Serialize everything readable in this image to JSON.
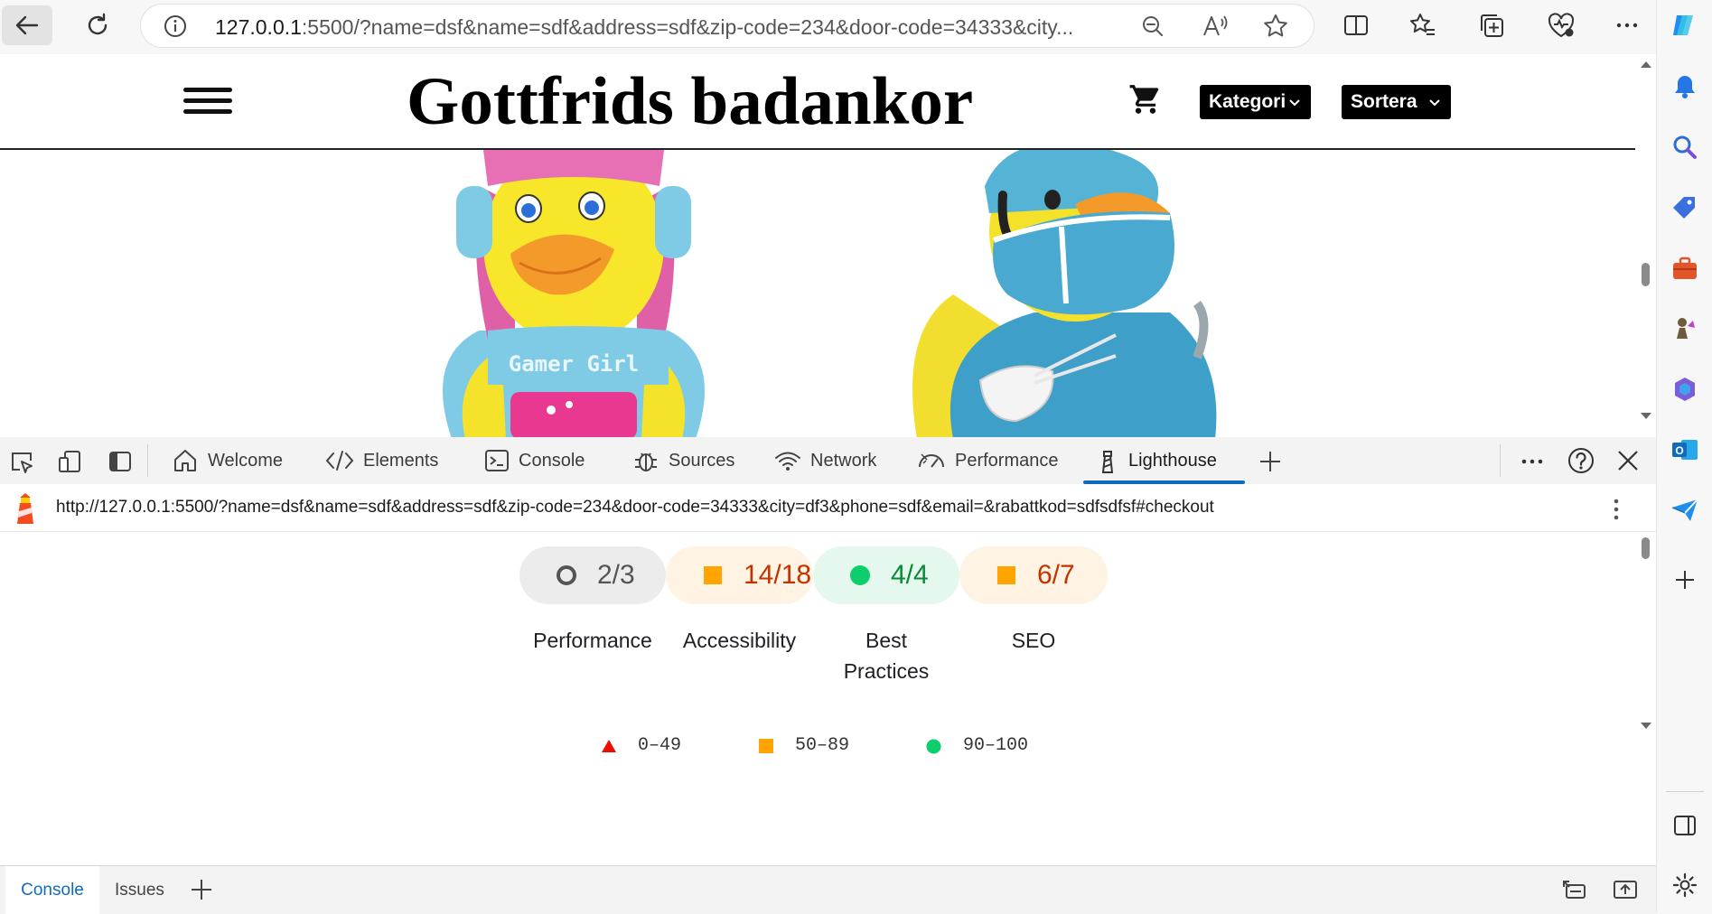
{
  "browser": {
    "address_host": "127.0.0.1",
    "address_rest": ":5500/?name=dsf&name=sdf&address=sdf&zip-code=234&door-code=34333&city..."
  },
  "site": {
    "title": "Gottfrids badankor",
    "kategori_label": "Kategori",
    "sortera_label": "Sortera",
    "duck1_print": "Gamer Girl"
  },
  "devtools": {
    "tabs": {
      "welcome": "Welcome",
      "elements": "Elements",
      "console": "Console",
      "sources": "Sources",
      "network": "Network",
      "performance": "Performance",
      "lighthouse": "Lighthouse"
    },
    "report_url": "http://127.0.0.1:5500/?name=dsf&name=sdf&address=sdf&zip-code=234&door-code=34333&city=df3&phone=sdf&email=&rabattkod=sdfsdfsf#checkout",
    "scores": [
      {
        "label": "Performance",
        "value": "2/3",
        "status": "neutral"
      },
      {
        "label": "Accessibility",
        "value": "14/18",
        "status": "average"
      },
      {
        "label_line1": "Best",
        "label_line2": "Practices",
        "value": "4/4",
        "status": "pass"
      },
      {
        "label": "SEO",
        "value": "6/7",
        "status": "average"
      }
    ],
    "legend": {
      "fail": "0–49",
      "average": "50–89",
      "pass": "90–100"
    },
    "drawer": {
      "console": "Console",
      "issues": "Issues"
    },
    "colors": {
      "fail": "#eb0f00",
      "average": "#ffa400",
      "pass": "#0cce6b",
      "accent": "#0f6cbd"
    }
  }
}
